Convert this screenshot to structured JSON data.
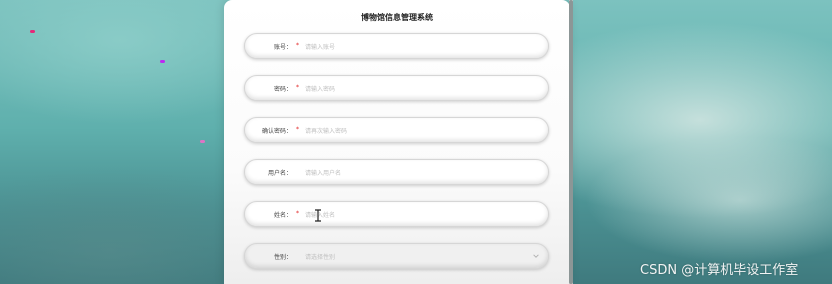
{
  "app": {
    "title": "博物馆信息管理系统"
  },
  "form": {
    "fields": [
      {
        "label": "账号：",
        "required": "*",
        "placeholder": "请输入账号"
      },
      {
        "label": "密码：",
        "required": "*",
        "placeholder": "请输入密码"
      },
      {
        "label": "确认密码：",
        "required": "*",
        "placeholder": "请再次输入密码"
      },
      {
        "label": "用户名：",
        "required": "",
        "placeholder": "请输入用户名"
      },
      {
        "label": "姓名：",
        "required": "*",
        "placeholder": "请输入姓名"
      },
      {
        "label": "性别：",
        "required": "",
        "placeholder": "请选择性别"
      }
    ]
  },
  "watermark": "CSDN @计算机毕设工作室",
  "colors": {
    "required": "#e02020",
    "background": "#6fb8b4",
    "panel": "#ffffff",
    "placeholder": "#c0c0c0"
  },
  "icons": {
    "select_arrow": "chevron-down-icon",
    "cursor": "text-cursor-icon"
  }
}
